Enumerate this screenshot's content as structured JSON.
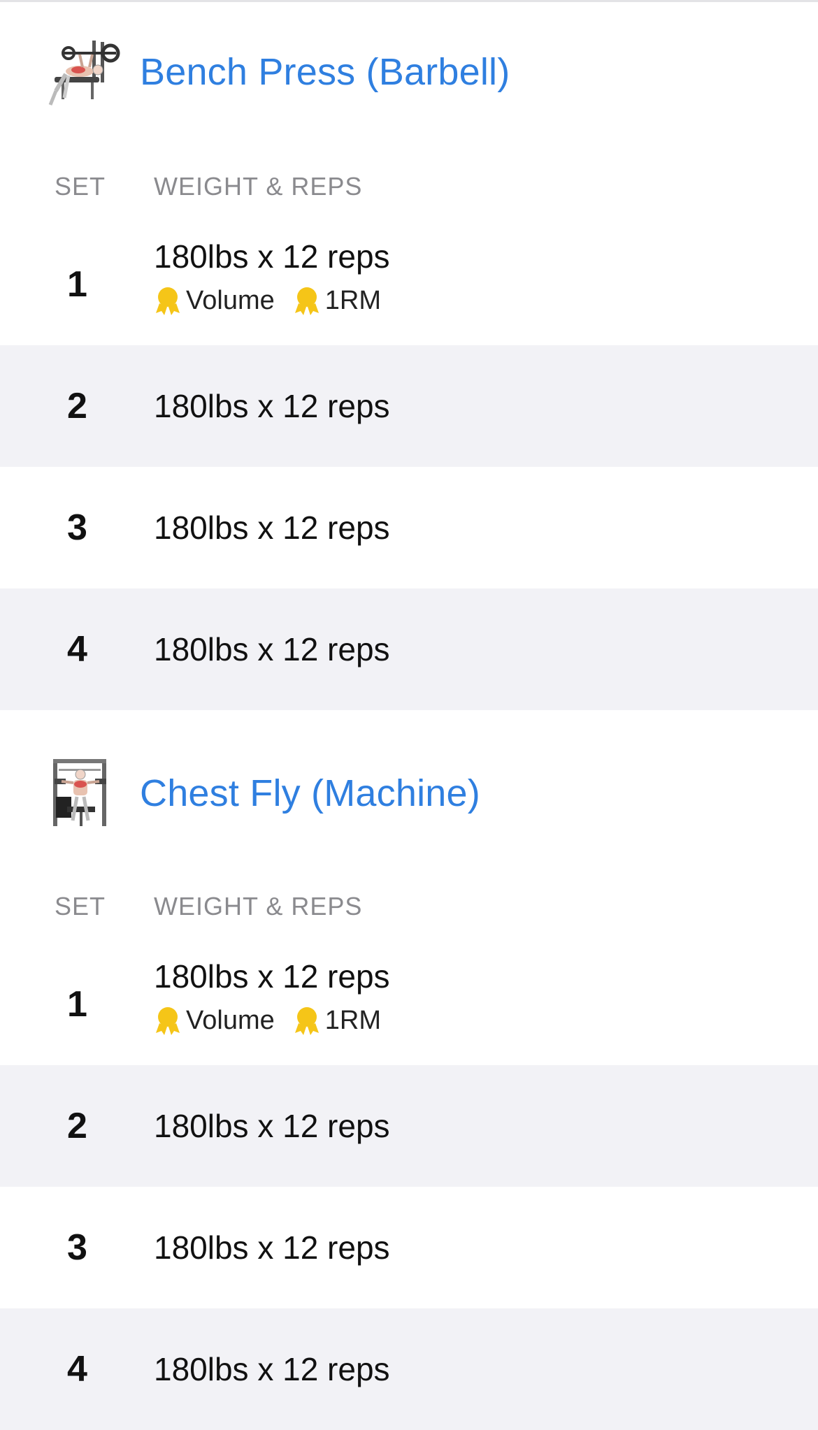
{
  "exercises": [
    {
      "name": "Bench Press (Barbell)",
      "icon": "bench-press-illustration",
      "columns": {
        "set": "SET",
        "weight_reps": "WEIGHT & REPS"
      },
      "sets": [
        {
          "number": "1",
          "value": "180lbs x 12 reps",
          "badges": [
            "Volume",
            "1RM"
          ]
        },
        {
          "number": "2",
          "value": "180lbs x 12 reps"
        },
        {
          "number": "3",
          "value": "180lbs x 12 reps"
        },
        {
          "number": "4",
          "value": "180lbs x 12 reps"
        }
      ]
    },
    {
      "name": "Chest Fly (Machine)",
      "icon": "chest-fly-machine-illustration",
      "columns": {
        "set": "SET",
        "weight_reps": "WEIGHT & REPS"
      },
      "sets": [
        {
          "number": "1",
          "value": "180lbs x 12 reps",
          "badges": [
            "Volume",
            "1RM"
          ]
        },
        {
          "number": "2",
          "value": "180lbs x 12 reps"
        },
        {
          "number": "3",
          "value": "180lbs x 12 reps"
        },
        {
          "number": "4",
          "value": "180lbs x 12 reps"
        }
      ]
    }
  ],
  "colors": {
    "title": "#2f7fe0",
    "row_alt": "#f2f2f6",
    "medal": "#f5c518"
  }
}
